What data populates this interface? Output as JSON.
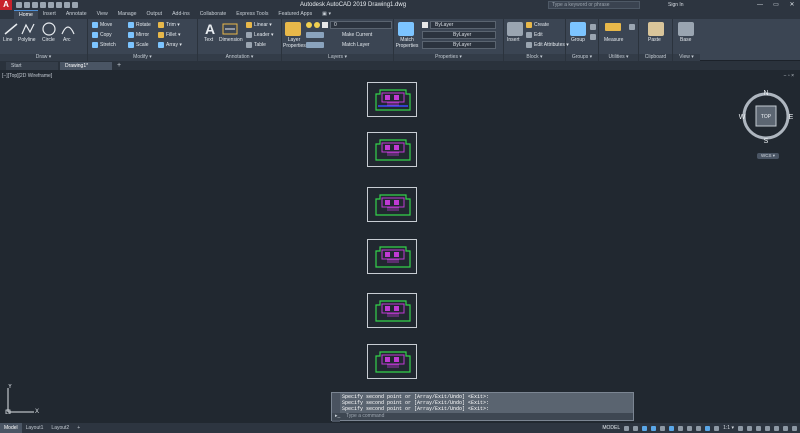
{
  "app": {
    "logo": "A",
    "title": "Autodesk AutoCAD 2019    Drawing1.dwg",
    "search_placeholder": "Type a keyword or phrase",
    "signin": "Sign In",
    "win_min": "—",
    "win_max": "▭",
    "win_close": "✕"
  },
  "tabs": [
    "Home",
    "Insert",
    "Annotate",
    "View",
    "Manage",
    "Output",
    "Add-ins",
    "Collaborate",
    "Express Tools",
    "Featured Apps",
    "▣ ▾"
  ],
  "panels": {
    "draw": {
      "title": "Draw ▾",
      "line": "Line",
      "polyline": "Polyline",
      "circle": "Circle",
      "arc": "Arc"
    },
    "modify": {
      "title": "Modify ▾",
      "move": "Move",
      "rotate": "Rotate",
      "trim": "Trim ▾",
      "copy": "Copy",
      "mirror": "Mirror",
      "fillet": "Fillet ▾",
      "stretch": "Stretch",
      "scale": "Scale",
      "array": "Array ▾"
    },
    "annotation": {
      "title": "Annotation ▾",
      "text": "Text",
      "dimension": "Dimension",
      "linear": "Linear ▾",
      "leader": "Leader ▾",
      "table": "Table"
    },
    "layers": {
      "title": "Layers ▾",
      "layer_props": "Layer Properties",
      "layer_value": "0",
      "make_current": "Make Current",
      "match_layer": "Match Layer"
    },
    "properties": {
      "title": "Properties ▾",
      "match": "Match Properties",
      "bylayer1": "ByLayer",
      "bylayer2": "ByLayer",
      "bylayer3": "ByLayer"
    },
    "block": {
      "title": "Block ▾",
      "insert": "Insert",
      "create": "Create",
      "edit": "Edit",
      "edit_attr": "Edit Attributes ▾"
    },
    "groups": {
      "title": "Groups ▾",
      "group": "Group"
    },
    "utilities": {
      "title": "Utilities ▾",
      "measure": "Measure"
    },
    "clipboard": {
      "title": "Clipboard",
      "paste": "Paste"
    },
    "view": {
      "title": "View ▾",
      "base": "Base"
    }
  },
  "doc_tabs": {
    "start": "Start",
    "drawing": "Drawing1*",
    "plus": "+"
  },
  "viewport": {
    "label": "[−][Top][2D Wireframe]",
    "vp_ctrl": "− ▫ ×"
  },
  "viewcube": {
    "n": "N",
    "s": "S",
    "e": "E",
    "w": "W",
    "face": "TOP",
    "wcs": "WCS ▾"
  },
  "ucs": {
    "x": "X",
    "y": "Y"
  },
  "command": {
    "lines": [
      "Specify second point or [Array/Exit/Undo] <Exit>:",
      "Specify second point or [Array/Exit/Undo] <Exit>:",
      "Specify second point or [Array/Exit/Undo] <Exit>:"
    ],
    "placeholder": "Type a command",
    "prompt_icon": "▸_"
  },
  "layouts": [
    "Model",
    "Layout1",
    "Layout2",
    "+"
  ],
  "status": {
    "model": "MODEL",
    "scale": "1:1 ▾"
  },
  "colors": {
    "purple": "#c03ad4",
    "green": "#33d34a",
    "blue": "#3a4cff",
    "frame": "#c8cdd3"
  }
}
